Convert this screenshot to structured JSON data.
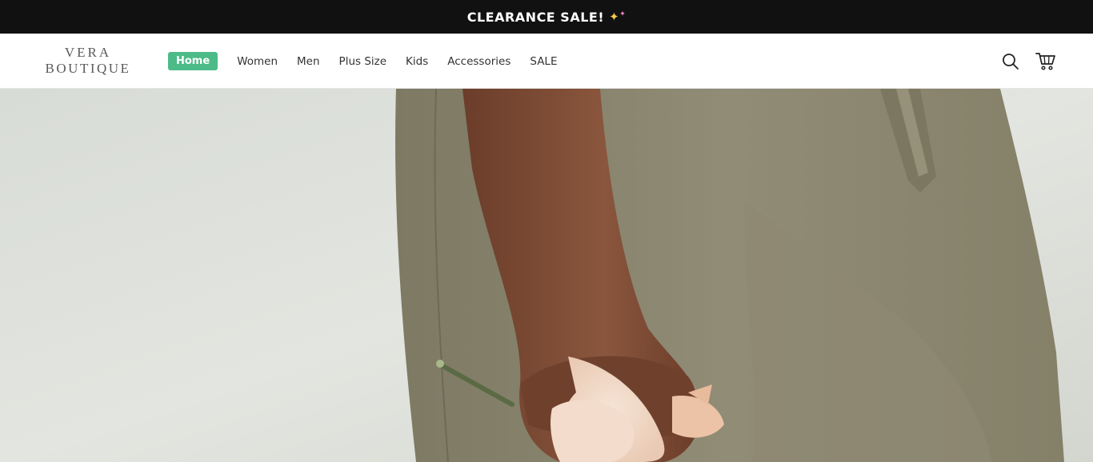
{
  "announcement": {
    "text": "CLEARANCE SALE!",
    "emoji_icon": "sparkles-icon"
  },
  "logo": {
    "line1": "VERA",
    "line2": "BOUTIQUE"
  },
  "nav": {
    "items": [
      {
        "label": "Home",
        "active": true
      },
      {
        "label": "Women",
        "active": false
      },
      {
        "label": "Men",
        "active": false
      },
      {
        "label": "Plus Size",
        "active": false
      },
      {
        "label": "Kids",
        "active": false
      },
      {
        "label": "Accessories",
        "active": false
      },
      {
        "label": "SALE",
        "active": false
      }
    ]
  },
  "header_icons": [
    "search-icon",
    "cart-icon"
  ],
  "colors": {
    "announcement_bg": "#111111",
    "active_nav_bg": "#4cbb87",
    "hero_backdrop": "#dfe2dc",
    "trousers": "#8a8570",
    "skin": "#7a4a34"
  },
  "hero": {
    "image_icon": "hero-photo-icon"
  }
}
